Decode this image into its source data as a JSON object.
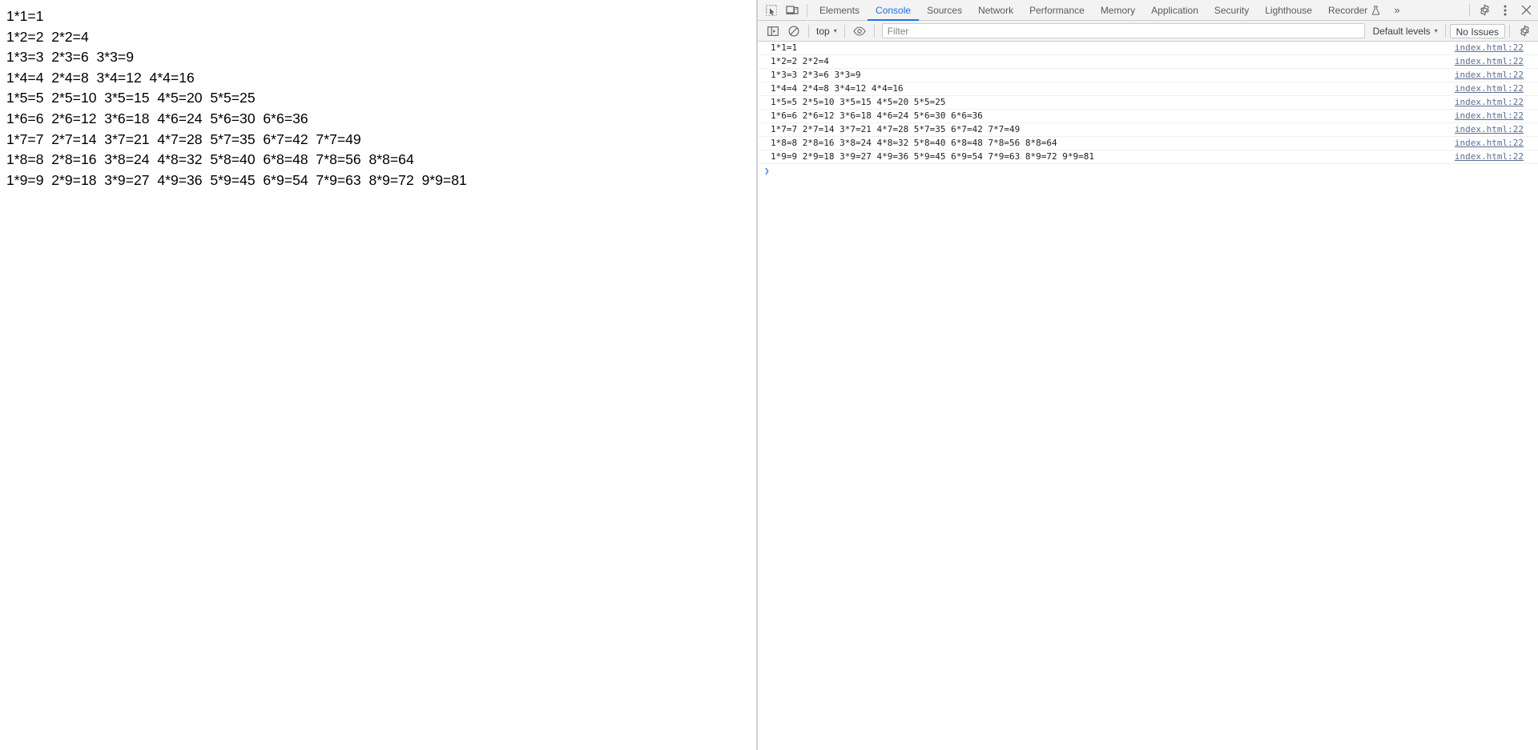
{
  "page": {
    "lines": [
      "1*1=1",
      "1*2=2  2*2=4",
      "1*3=3  2*3=6  3*3=9",
      "1*4=4  2*4=8  3*4=12  4*4=16",
      "1*5=5  2*5=10  3*5=15  4*5=20  5*5=25",
      "1*6=6  2*6=12  3*6=18  4*6=24  5*6=30  6*6=36",
      "1*7=7  2*7=14  3*7=21  4*7=28  5*7=35  6*7=42  7*7=49",
      "1*8=8  2*8=16  3*8=24  4*8=32  5*8=40  6*8=48  7*8=56  8*8=64",
      "1*9=9  2*9=18  3*9=27  4*9=36  5*9=45  6*9=54  7*9=63  8*9=72  9*9=81"
    ]
  },
  "devtools": {
    "tabstrip": {
      "inspect_icon": "inspect-element-icon",
      "device_icon": "device-toolbar-icon",
      "tabs": [
        {
          "label": "Elements",
          "active": false
        },
        {
          "label": "Console",
          "active": true
        },
        {
          "label": "Sources",
          "active": false
        },
        {
          "label": "Network",
          "active": false
        },
        {
          "label": "Performance",
          "active": false
        },
        {
          "label": "Memory",
          "active": false
        },
        {
          "label": "Application",
          "active": false
        },
        {
          "label": "Security",
          "active": false
        },
        {
          "label": "Lighthouse",
          "active": false
        },
        {
          "label": "Recorder",
          "active": false,
          "icon": "flask-icon"
        }
      ],
      "more_tabs_label": "»",
      "settings_icon": "gear-icon",
      "more_options_icon": "kebab-menu-icon",
      "close_icon": "close-icon",
      "active_tab_color": "#1a73e8"
    },
    "console_toolbar": {
      "sidebar_toggle_icon": "console-sidebar-icon",
      "clear_console_icon": "clear-console-icon",
      "context": "top",
      "context_caret": "▾",
      "live_expression_icon": "eye-icon",
      "filter_placeholder": "Filter",
      "filter_value": "",
      "levels_label": "Default levels",
      "levels_caret": "▾",
      "issues_label": "No Issues",
      "settings_icon": "gear-icon"
    },
    "console": {
      "messages": [
        {
          "text": "1*1=1",
          "source": "index.html:22"
        },
        {
          "text": "1*2=2 2*2=4",
          "source": "index.html:22"
        },
        {
          "text": "1*3=3 2*3=6 3*3=9",
          "source": "index.html:22"
        },
        {
          "text": "1*4=4 2*4=8 3*4=12 4*4=16",
          "source": "index.html:22"
        },
        {
          "text": "1*5=5 2*5=10 3*5=15 4*5=20 5*5=25",
          "source": "index.html:22"
        },
        {
          "text": "1*6=6 2*6=12 3*6=18 4*6=24 5*6=30 6*6=36",
          "source": "index.html:22"
        },
        {
          "text": "1*7=7 2*7=14 3*7=21 4*7=28 5*7=35 6*7=42 7*7=49",
          "source": "index.html:22"
        },
        {
          "text": "1*8=8 2*8=16 3*8=24 4*8=32 5*8=40 6*8=48 7*8=56 8*8=64",
          "source": "index.html:22"
        },
        {
          "text": "1*9=9 2*9=18 3*9=27 4*9=36 5*9=45 6*9=54 7*9=63 8*9=72 9*9=81",
          "source": "index.html:22"
        }
      ],
      "prompt_symbol": "❯",
      "prompt_value": "",
      "prompt_color": "#4285f4"
    }
  }
}
